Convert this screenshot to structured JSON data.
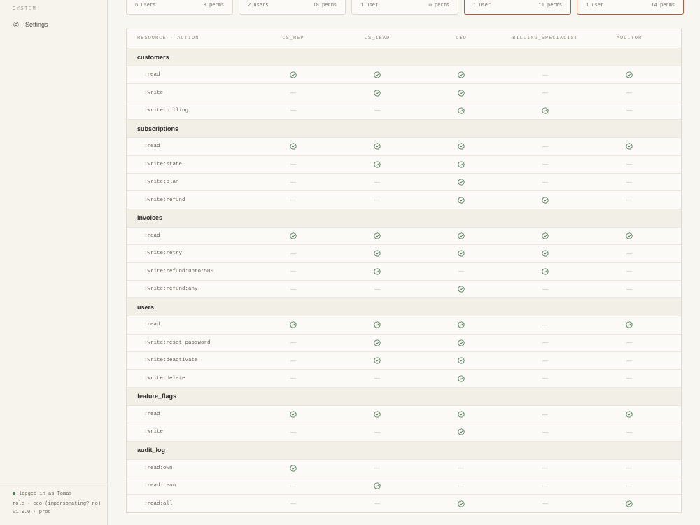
{
  "sidebar": {
    "section": "SYSTEM",
    "settings_label": "Settings",
    "footer": {
      "logged_in": "logged in as Tomas",
      "role": "role · ceo (impersonating? no)",
      "version": "v1.0.0 · prod"
    }
  },
  "role_cards": [
    {
      "users": "6 users",
      "perms": "8 perms",
      "highlighted": false
    },
    {
      "users": "2 users",
      "perms": "18 perms",
      "highlighted": false
    },
    {
      "users": "1 user",
      "perms": "∞ perms",
      "highlighted": false
    },
    {
      "users": "1 user",
      "perms": "11 perms",
      "highlighted": true
    },
    {
      "users": "1 user",
      "perms": "14 perms",
      "highlighted": true
    }
  ],
  "matrix": {
    "header": {
      "resource_action": "RESOURCE · ACTION",
      "roles": [
        "CS_REP",
        "CS_LEAD",
        "CEO",
        "BILLING_SPECIALIST",
        "AUDITOR"
      ]
    },
    "dash": "—",
    "groups": [
      {
        "name": "customers",
        "rows": [
          {
            "action": ":read",
            "perms": [
              true,
              true,
              true,
              false,
              true
            ]
          },
          {
            "action": ":write",
            "perms": [
              false,
              true,
              true,
              false,
              false
            ]
          },
          {
            "action": ":write:billing",
            "perms": [
              false,
              false,
              true,
              true,
              false
            ]
          }
        ]
      },
      {
        "name": "subscriptions",
        "rows": [
          {
            "action": ":read",
            "perms": [
              true,
              true,
              true,
              false,
              true
            ]
          },
          {
            "action": ":write:state",
            "perms": [
              false,
              true,
              true,
              false,
              false
            ]
          },
          {
            "action": ":write:plan",
            "perms": [
              false,
              false,
              true,
              false,
              false
            ]
          },
          {
            "action": ":write:refund",
            "perms": [
              false,
              false,
              true,
              true,
              false
            ]
          }
        ]
      },
      {
        "name": "invoices",
        "rows": [
          {
            "action": ":read",
            "perms": [
              true,
              true,
              true,
              true,
              true
            ]
          },
          {
            "action": ":write:retry",
            "perms": [
              false,
              true,
              true,
              true,
              false
            ]
          },
          {
            "action": ":write:refund:upto:500",
            "perms": [
              false,
              true,
              false,
              true,
              false
            ]
          },
          {
            "action": ":write:refund:any",
            "perms": [
              false,
              false,
              true,
              false,
              false
            ]
          }
        ]
      },
      {
        "name": "users",
        "rows": [
          {
            "action": ":read",
            "perms": [
              true,
              true,
              true,
              false,
              true
            ]
          },
          {
            "action": ":write:reset_password",
            "perms": [
              false,
              true,
              true,
              false,
              false
            ]
          },
          {
            "action": ":write:deactivate",
            "perms": [
              false,
              true,
              true,
              false,
              false
            ]
          },
          {
            "action": ":write:delete",
            "perms": [
              false,
              false,
              true,
              false,
              false
            ]
          }
        ]
      },
      {
        "name": "feature_flags",
        "rows": [
          {
            "action": ":read",
            "perms": [
              true,
              true,
              true,
              false,
              true
            ]
          },
          {
            "action": ":write",
            "perms": [
              false,
              false,
              true,
              false,
              false
            ]
          }
        ]
      },
      {
        "name": "audit_log",
        "rows": [
          {
            "action": ":read:own",
            "perms": [
              true,
              false,
              false,
              false,
              false
            ]
          },
          {
            "action": ":read:team",
            "perms": [
              false,
              true,
              false,
              false,
              false
            ]
          },
          {
            "action": ":read:all",
            "perms": [
              false,
              false,
              true,
              false,
              true
            ]
          }
        ]
      }
    ]
  },
  "colors": {
    "check": "#4f7d5a",
    "highlight_border": "#b55c3d",
    "background": "#f8f6f0"
  },
  "icons": {
    "settings": "gear-icon",
    "granted": "check-circle-icon",
    "denied": "dash"
  }
}
